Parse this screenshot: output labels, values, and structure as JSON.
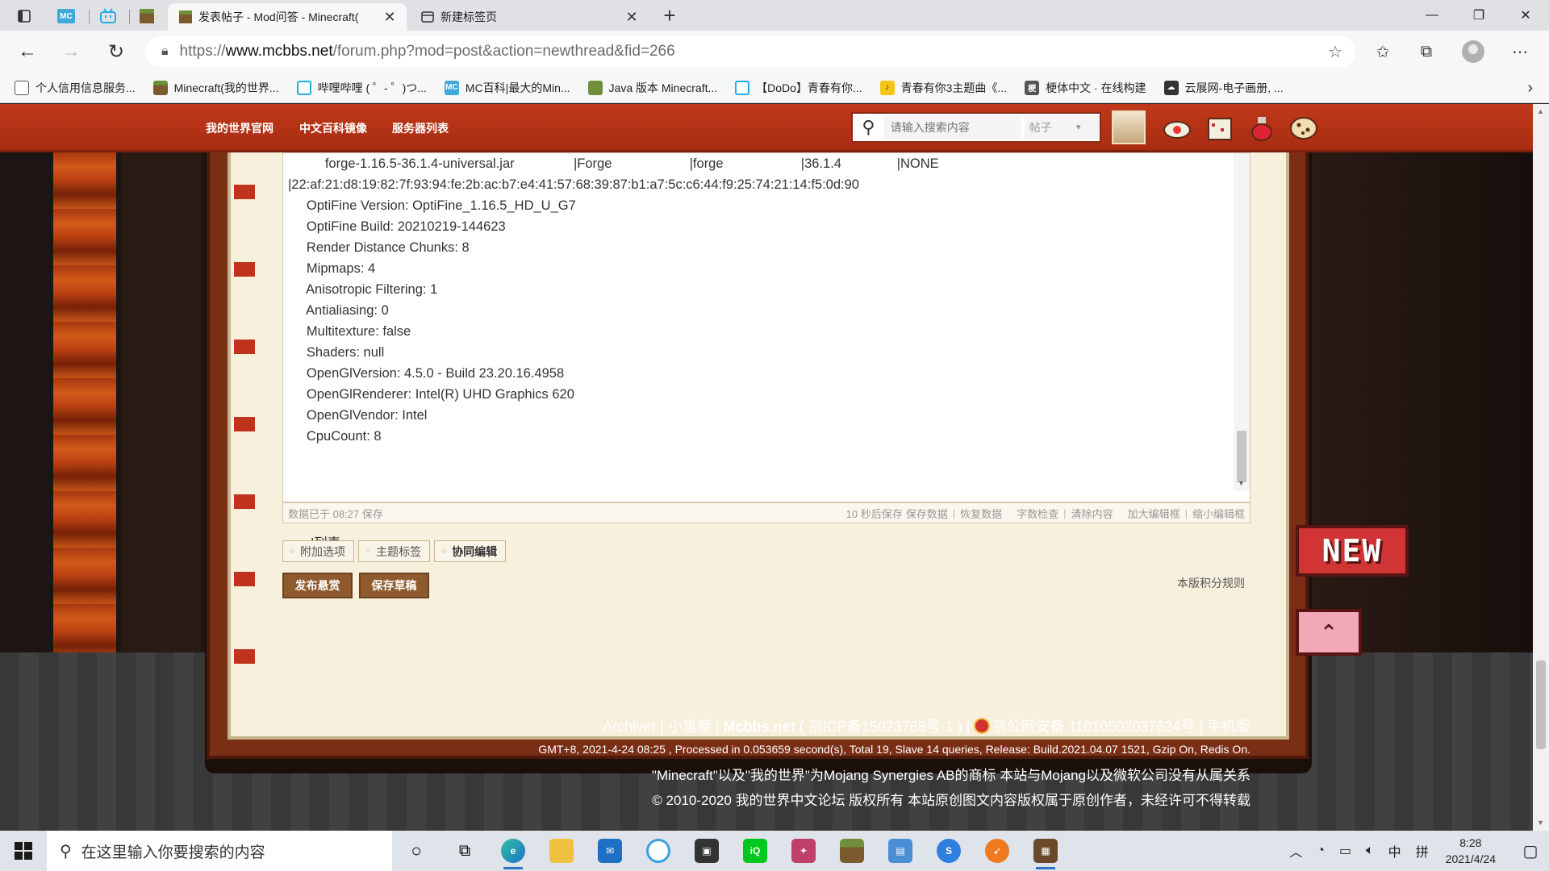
{
  "browser": {
    "tabs": [
      {
        "title": "发表帖子 - Mod问答 - Minecraft(",
        "active": true
      },
      {
        "title": "新建标签页",
        "active": false
      }
    ],
    "url": {
      "protocol": "https://",
      "host": "www.mcbbs.net",
      "path": "/forum.php?mod=post&action=newthread&fid=266"
    },
    "bookmarks": [
      {
        "label": "个人信用信息服务...",
        "icon": "document-icon",
        "color": "#ffffff"
      },
      {
        "label": "Minecraft(我的世界...",
        "icon": "grass-block-icon",
        "color": "#7b5a2e"
      },
      {
        "label": "哔哩哔哩 ( ゜- ゜)つ...",
        "icon": "bilibili-icon",
        "color": "#23ade5"
      },
      {
        "label": "MC百科|最大的Min...",
        "icon": "mc-wiki-icon",
        "color": "#3fa9d8"
      },
      {
        "label": "Java 版本 Minecraft...",
        "icon": "minecraft-cube-icon",
        "color": "#6f8f3a"
      },
      {
        "label": "【DoDo】青春有你...",
        "icon": "bilibili-icon",
        "color": "#23ade5"
      },
      {
        "label": "青春有你3主题曲《...",
        "icon": "yellow-app-icon",
        "color": "#f5c518"
      },
      {
        "label": "梗体中文 · 在线构建",
        "icon": "meme-site-icon",
        "color": "#555555"
      },
      {
        "label": "云展网-电子画册, ...",
        "icon": "cloud-site-icon",
        "color": "#333333"
      }
    ]
  },
  "site": {
    "nav": [
      "我的世界官网",
      "中文百科镜像",
      "服务器列表"
    ],
    "search": {
      "placeholder": "请输入搜索内容",
      "type": "帖子"
    },
    "editor": {
      "lines": [
        "          forge-1.16.5-36.1.4-universal.jar                |Forge                     |forge                     |36.1.4               |NONE",
        "|22:af:21:d8:19:82:7f:93:94:fe:2b:ac:b7:e4:41:57:68:39:87:b1:a7:5c:c6:44:f9:25:74:21:14:f5:0d:90",
        "     OptiFine Version: OptiFine_1.16.5_HD_U_G7",
        "     OptiFine Build: 20210219-144623",
        "     Render Distance Chunks: 8",
        "     Mipmaps: 4",
        "     Anisotropic Filtering: 1",
        "     Antialiasing: 0",
        "     Multitexture: false",
        "     Shaders: null",
        "     OpenGlVersion: 4.5.0 - Build 23.20.16.4958",
        "     OpenGlRenderer: Intel(R) UHD Graphics 620",
        "     OpenGlVendor: Intel",
        "     CpuCount: 8"
      ],
      "modlist_label": "mod列表:"
    },
    "statusbar": {
      "saved": "数据已于 08:27 保存",
      "autosave": "10 秒后保存",
      "save_data": "保存数据",
      "restore": "恢复数据",
      "wordcheck": "字数检查",
      "clear": "清除内容",
      "enlarge": "加大编辑框",
      "shrink": "缩小编辑框"
    },
    "options": [
      "附加选项",
      "主题标签",
      "协同编辑"
    ],
    "buttons": {
      "publish": "发布悬赏",
      "draft": "保存草稿"
    },
    "rules_link": "本版积分规则",
    "badges": {
      "new": "NEW"
    },
    "footer": {
      "archiver": "Archiver",
      "blackroom": "小黑屋",
      "site": "Mcbbs.net",
      "icp": "( 京ICP备15023768号-1 )",
      "police": "京公网安备 11010502037624号",
      "mobile": "手机版",
      "stats": "GMT+8, 2021-4-24 08:25 , Processed in 0.053659 second(s), Total 19, Slave 14 queries, Release: Build.2021.04.07 1521, Gzip On, Redis On.",
      "trademark": "\"Minecraft\"以及\"我的世界\"为Mojang Synergies AB的商标 本站与Mojang以及微软公司没有从属关系",
      "copyright": "© 2010-2020 我的世界中文论坛 版权所有 本站原创图文内容版权属于原创作者，未经许可不得转载"
    }
  },
  "taskbar": {
    "search_placeholder": "在这里输入你要搜索的内容",
    "ime": "中",
    "ime_mode": "拼",
    "time": "8:28",
    "date": "2021/4/24"
  }
}
